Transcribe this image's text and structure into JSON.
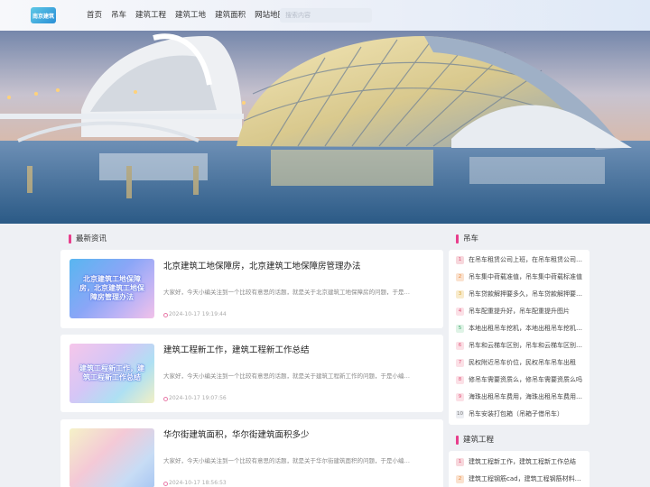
{
  "header": {
    "logo_text": "南京建筑",
    "nav": [
      "首页",
      "吊车",
      "建筑工程",
      "建筑工地",
      "建筑面积",
      "网站地图"
    ],
    "search_placeholder": "搜索内容"
  },
  "main": {
    "section_title": "最新资讯",
    "articles": [
      {
        "thumb_text": "北京建筑工地保障房，北京建筑工地保障房管理办法",
        "title": "北京建筑工地保障房，北京建筑工地保障房管理办法",
        "excerpt": "大家好，今天小编关注到一个比较有意思的话题，就是关于北京建筑工地保障房的问题，于是…",
        "time": "2024-10-17 19:19:44"
      },
      {
        "thumb_text": "建筑工程新工作，建筑工程新工作总结",
        "title": "建筑工程新工作，建筑工程新工作总结",
        "excerpt": "大家好，今天小编关注到一个比较有意思的话题，就是关于建筑工程新工作的问题，于是小编…",
        "time": "2024-10-17 19:07:56"
      },
      {
        "thumb_text": "",
        "title": "华尔街建筑面积，华尔街建筑面积多少",
        "excerpt": "大家好，今天小编关注到一个比较有意思的话题，就是关于华尔街建筑面积的问题，于是小编…",
        "time": "2024-10-17 18:56:53"
      }
    ]
  },
  "sidebar": {
    "section1": {
      "title": "吊车",
      "items": [
        "在吊车租赁公司上班，在吊车租赁公司上班怎么样",
        "吊车集中荷载准值，吊车集中荷载标准值",
        "吊车贷款解押要多久，吊车贷款解押要多久时间",
        "吊车配重提升好，吊车配重提升图片",
        "本地出租吊车挖机，本地出租吊车挖机电话",
        "吊车和云梯车区别，吊车和云梯车区别在哪",
        "民权附近吊车价位，民权吊车吊车出租",
        "修吊车需要资质么，修吊车需要资质么吗",
        "海珠出租吊车费用，海珠出租吊车费用多少",
        "吊车安装打包箱（吊箱子借吊车）"
      ]
    },
    "section2": {
      "title": "建筑工程",
      "items": [
        "建筑工程新工作，建筑工程新工作总结",
        "建筑工程钢筋cad，建筑工程钢筋材料…"
      ]
    }
  },
  "colors": {
    "accent": "#e83e8c",
    "rank_colors": [
      "#f0c9cd",
      "#f7dcc3",
      "#f5e3c0",
      "#e9ecef"
    ]
  }
}
